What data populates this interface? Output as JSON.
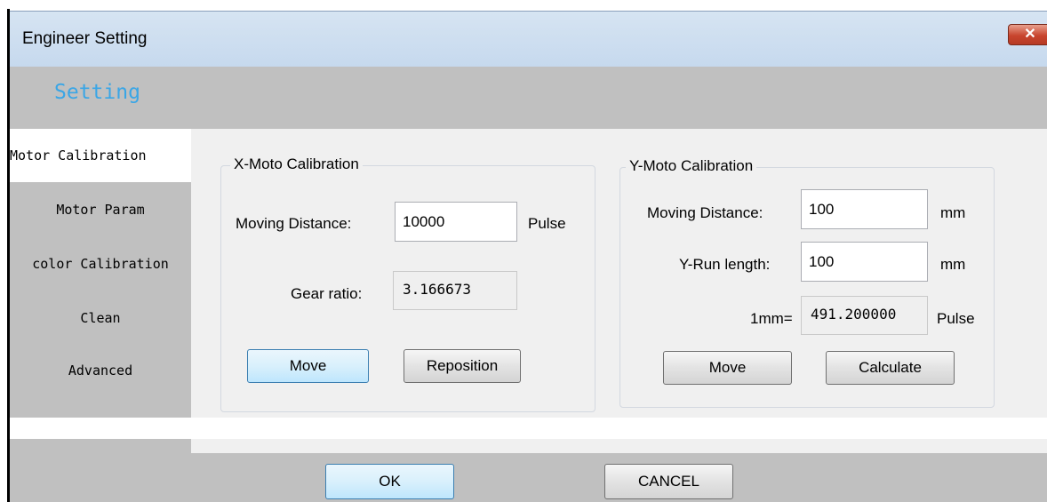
{
  "window": {
    "title": "Engineer Setting",
    "close_glyph": "✕"
  },
  "header": {
    "section_title": "Setting"
  },
  "sidebar": {
    "items": [
      {
        "label": "Motor Calibration"
      },
      {
        "label": "Motor Param"
      },
      {
        "label": "color Calibration"
      },
      {
        "label": "Clean"
      },
      {
        "label": "Advanced"
      }
    ]
  },
  "x_calibration": {
    "legend": "X-Moto Calibration",
    "moving_distance_label": "Moving Distance:",
    "moving_distance_value": "10000",
    "moving_distance_unit": "Pulse",
    "gear_ratio_label": "Gear ratio:",
    "gear_ratio_value": "3.166673",
    "move_label": "Move",
    "reposition_label": "Reposition"
  },
  "y_calibration": {
    "legend": "Y-Moto Calibration",
    "moving_distance_label": "Moving Distance:",
    "moving_distance_value": "100",
    "moving_distance_unit": "mm",
    "run_length_label": "Y-Run length:",
    "run_length_value": "100",
    "run_length_unit": "mm",
    "per_mm_label": "1mm=",
    "per_mm_value": "491.200000",
    "per_mm_unit": "Pulse",
    "move_label": "Move",
    "calculate_label": "Calculate"
  },
  "footer": {
    "ok_label": "OK",
    "cancel_label": "CANCEL"
  },
  "colors": {
    "title_accent": "#3aa6e6",
    "panel_gray": "#c0c0c0",
    "content_bg": "#f0f0f0"
  }
}
